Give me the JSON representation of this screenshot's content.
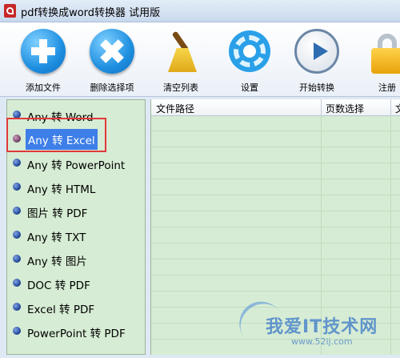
{
  "window": {
    "title": "pdf转换成word转换器 试用版"
  },
  "toolbar": {
    "items": [
      {
        "label": "添加文件",
        "icon": "add-icon"
      },
      {
        "label": "删除选择项",
        "icon": "delete-icon"
      },
      {
        "label": "清空列表",
        "icon": "broom-icon"
      },
      {
        "label": "设置",
        "icon": "gear-icon"
      },
      {
        "label": "开始转换",
        "icon": "play-icon"
      },
      {
        "label": "注册",
        "icon": "lock-icon"
      }
    ]
  },
  "sidebar": {
    "selected_index": 1,
    "items": [
      {
        "label": "Any 转 Word"
      },
      {
        "label": "Any 转 Excel"
      },
      {
        "label": "Any 转 PowerPoint"
      },
      {
        "label": "Any 转 HTML"
      },
      {
        "label": "图片 转 PDF"
      },
      {
        "label": "Any 转 TXT"
      },
      {
        "label": "Any 转 图片"
      },
      {
        "label": "DOC 转 PDF"
      },
      {
        "label": "Excel 转 PDF"
      },
      {
        "label": "PowerPoint 转 PDF"
      }
    ]
  },
  "table": {
    "columns": [
      {
        "label": "文件路径"
      },
      {
        "label": "页数选择"
      },
      {
        "label": "文"
      }
    ]
  },
  "watermark": {
    "text": "我爱IT技术网",
    "url": "www.52ij.com"
  },
  "colors": {
    "selection": "#3d7ee8",
    "highlight_box": "#e0393a",
    "list_bg": "#d6ecd4"
  }
}
